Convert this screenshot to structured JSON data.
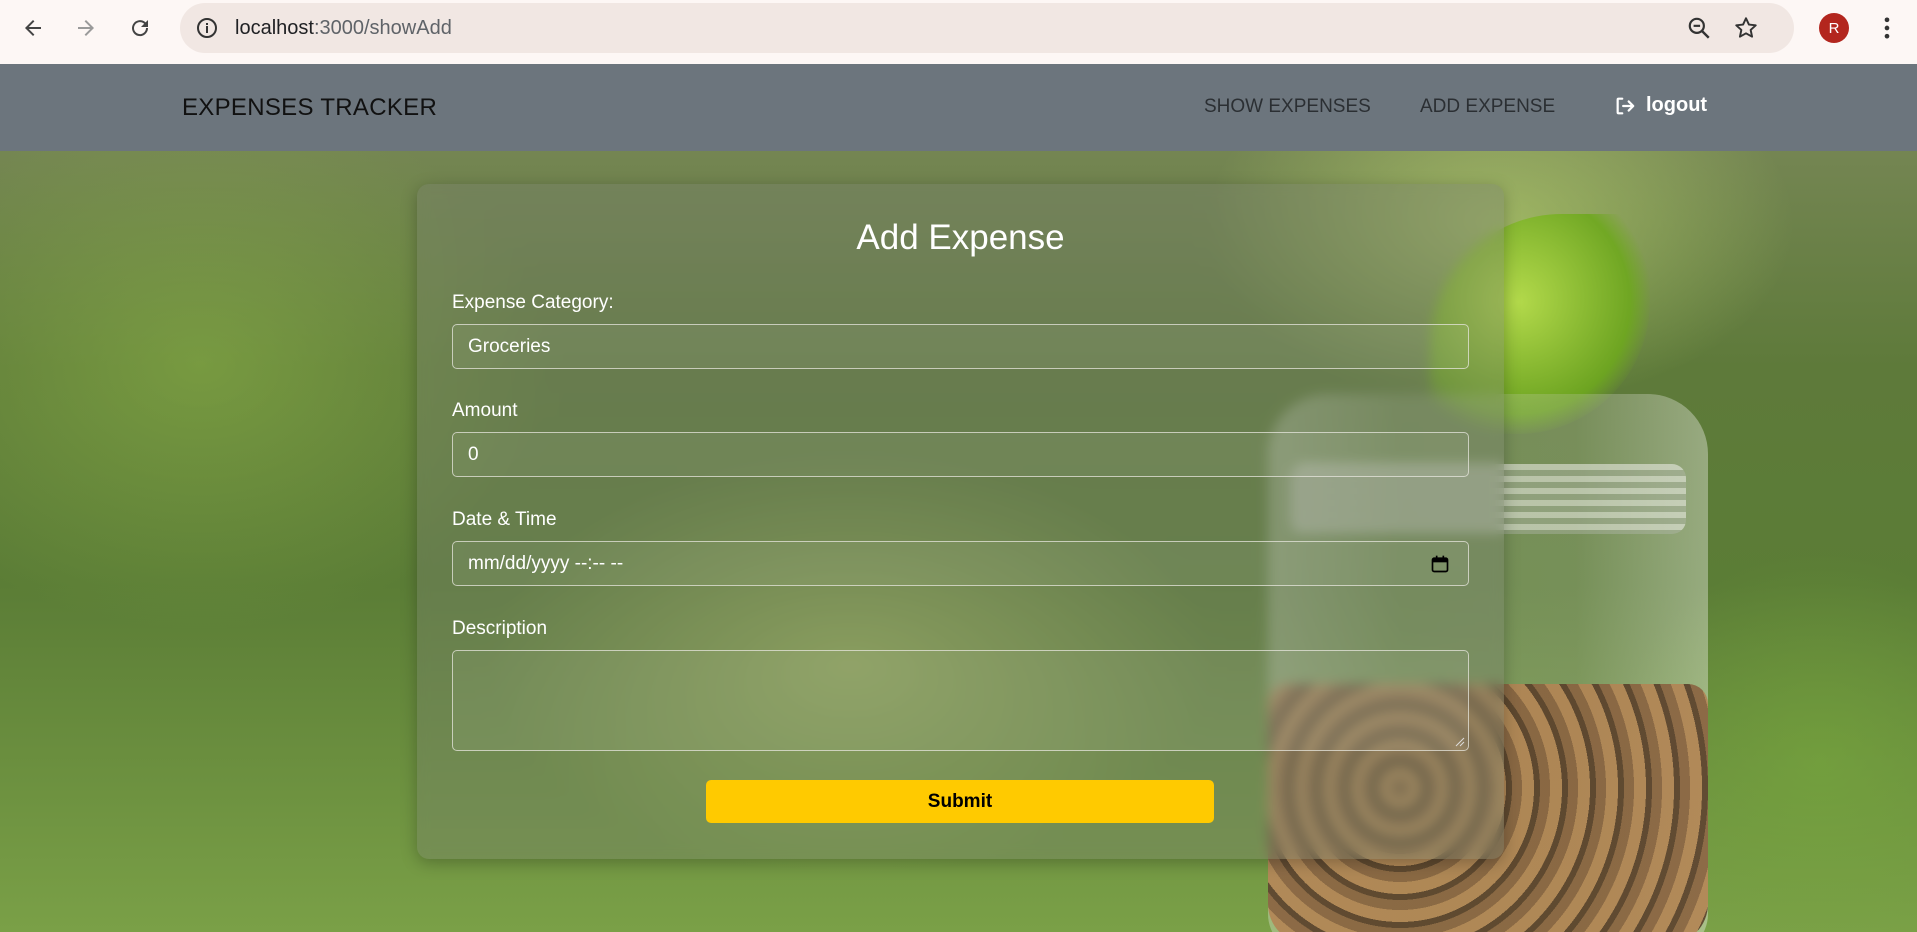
{
  "browser": {
    "url_host": "localhost",
    "url_path": ":3000/showAdd",
    "avatar_letter": "R",
    "icons": [
      "back-arrow-icon",
      "forward-arrow-icon",
      "reload-icon",
      "site-info-icon",
      "zoom-icon",
      "bookmark-star-icon",
      "kebab-menu-icon"
    ]
  },
  "navbar": {
    "brand": "EXPENSES TRACKER",
    "links": [
      {
        "label": "SHOW EXPENSES"
      },
      {
        "label": "ADD EXPENSE"
      }
    ],
    "logout_label": "logout",
    "background_color": "#6c757d"
  },
  "form": {
    "title": "Add Expense",
    "category_label": "Expense Category:",
    "category_value": "Groceries",
    "amount_label": "Amount",
    "amount_value": "0",
    "datetime_label": "Date & Time",
    "datetime_placeholder": "mm/dd/yyyy --:-- --",
    "description_label": "Description",
    "description_value": "",
    "submit_label": "Submit",
    "submit_color": "#ffca00"
  }
}
